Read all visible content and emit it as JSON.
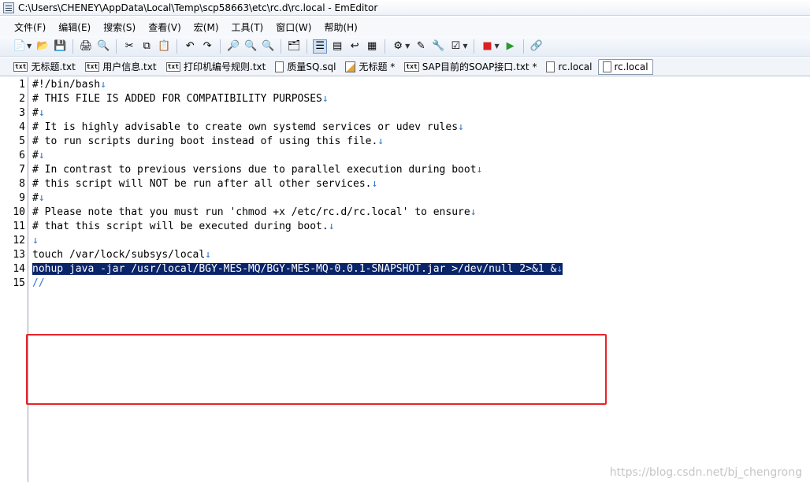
{
  "window": {
    "title": "C:\\Users\\CHENEY\\AppData\\Local\\Temp\\scp58663\\etc\\rc.d\\rc.local - EmEditor"
  },
  "menu": [
    "文件(F)",
    "编辑(E)",
    "搜索(S)",
    "查看(V)",
    "宏(M)",
    "工具(T)",
    "窗口(W)",
    "帮助(H)"
  ],
  "tabs": [
    {
      "label": "无标题.txt",
      "icon": "txt"
    },
    {
      "label": "用户信息.txt",
      "icon": "txt"
    },
    {
      "label": "打印机编号规则.txt",
      "icon": "txt"
    },
    {
      "label": "质量SQ.sql",
      "icon": "page"
    },
    {
      "label": "无标题 *",
      "icon": "edit"
    },
    {
      "label": "SAP目前的SOAP接口.txt *",
      "icon": "txt"
    },
    {
      "label": "rc.local",
      "icon": "page"
    },
    {
      "label": "rc.local",
      "icon": "page",
      "active": true
    }
  ],
  "editor": {
    "line_numbers": [
      "1",
      "2",
      "3",
      "4",
      "5",
      "6",
      "7",
      "8",
      "9",
      "10",
      "11",
      "12",
      "13",
      "14",
      "15"
    ],
    "lines": [
      "#!/bin/bash",
      "# THIS FILE IS ADDED FOR COMPATIBILITY PURPOSES",
      "#",
      "# It is highly advisable to create own systemd services or udev rules",
      "# to run scripts during boot instead of using this file.",
      "#",
      "# In contrast to previous versions due to parallel execution during boot",
      "# this script will NOT be run after all other services.",
      "#",
      "# Please note that you must run 'chmod +x /etc/rc.d/rc.local' to ensure",
      "# that this script will be executed during boot.",
      "",
      "touch /var/lock/subsys/local",
      "nohup java -jar /usr/local/BGY-MES-MQ/BGY-MES-MQ-0.0.1-SNAPSHOT.jar >/dev/null 2>&1 &",
      ""
    ],
    "eol_mark": "↓",
    "eof_mark": "//",
    "selected_line_index": 13
  },
  "watermark": "https://blog.csdn.net/bj_chengrong",
  "colors": {
    "selection": "#0a246a",
    "eol": "#2f74d0",
    "highlight_box": "#e8242a"
  }
}
